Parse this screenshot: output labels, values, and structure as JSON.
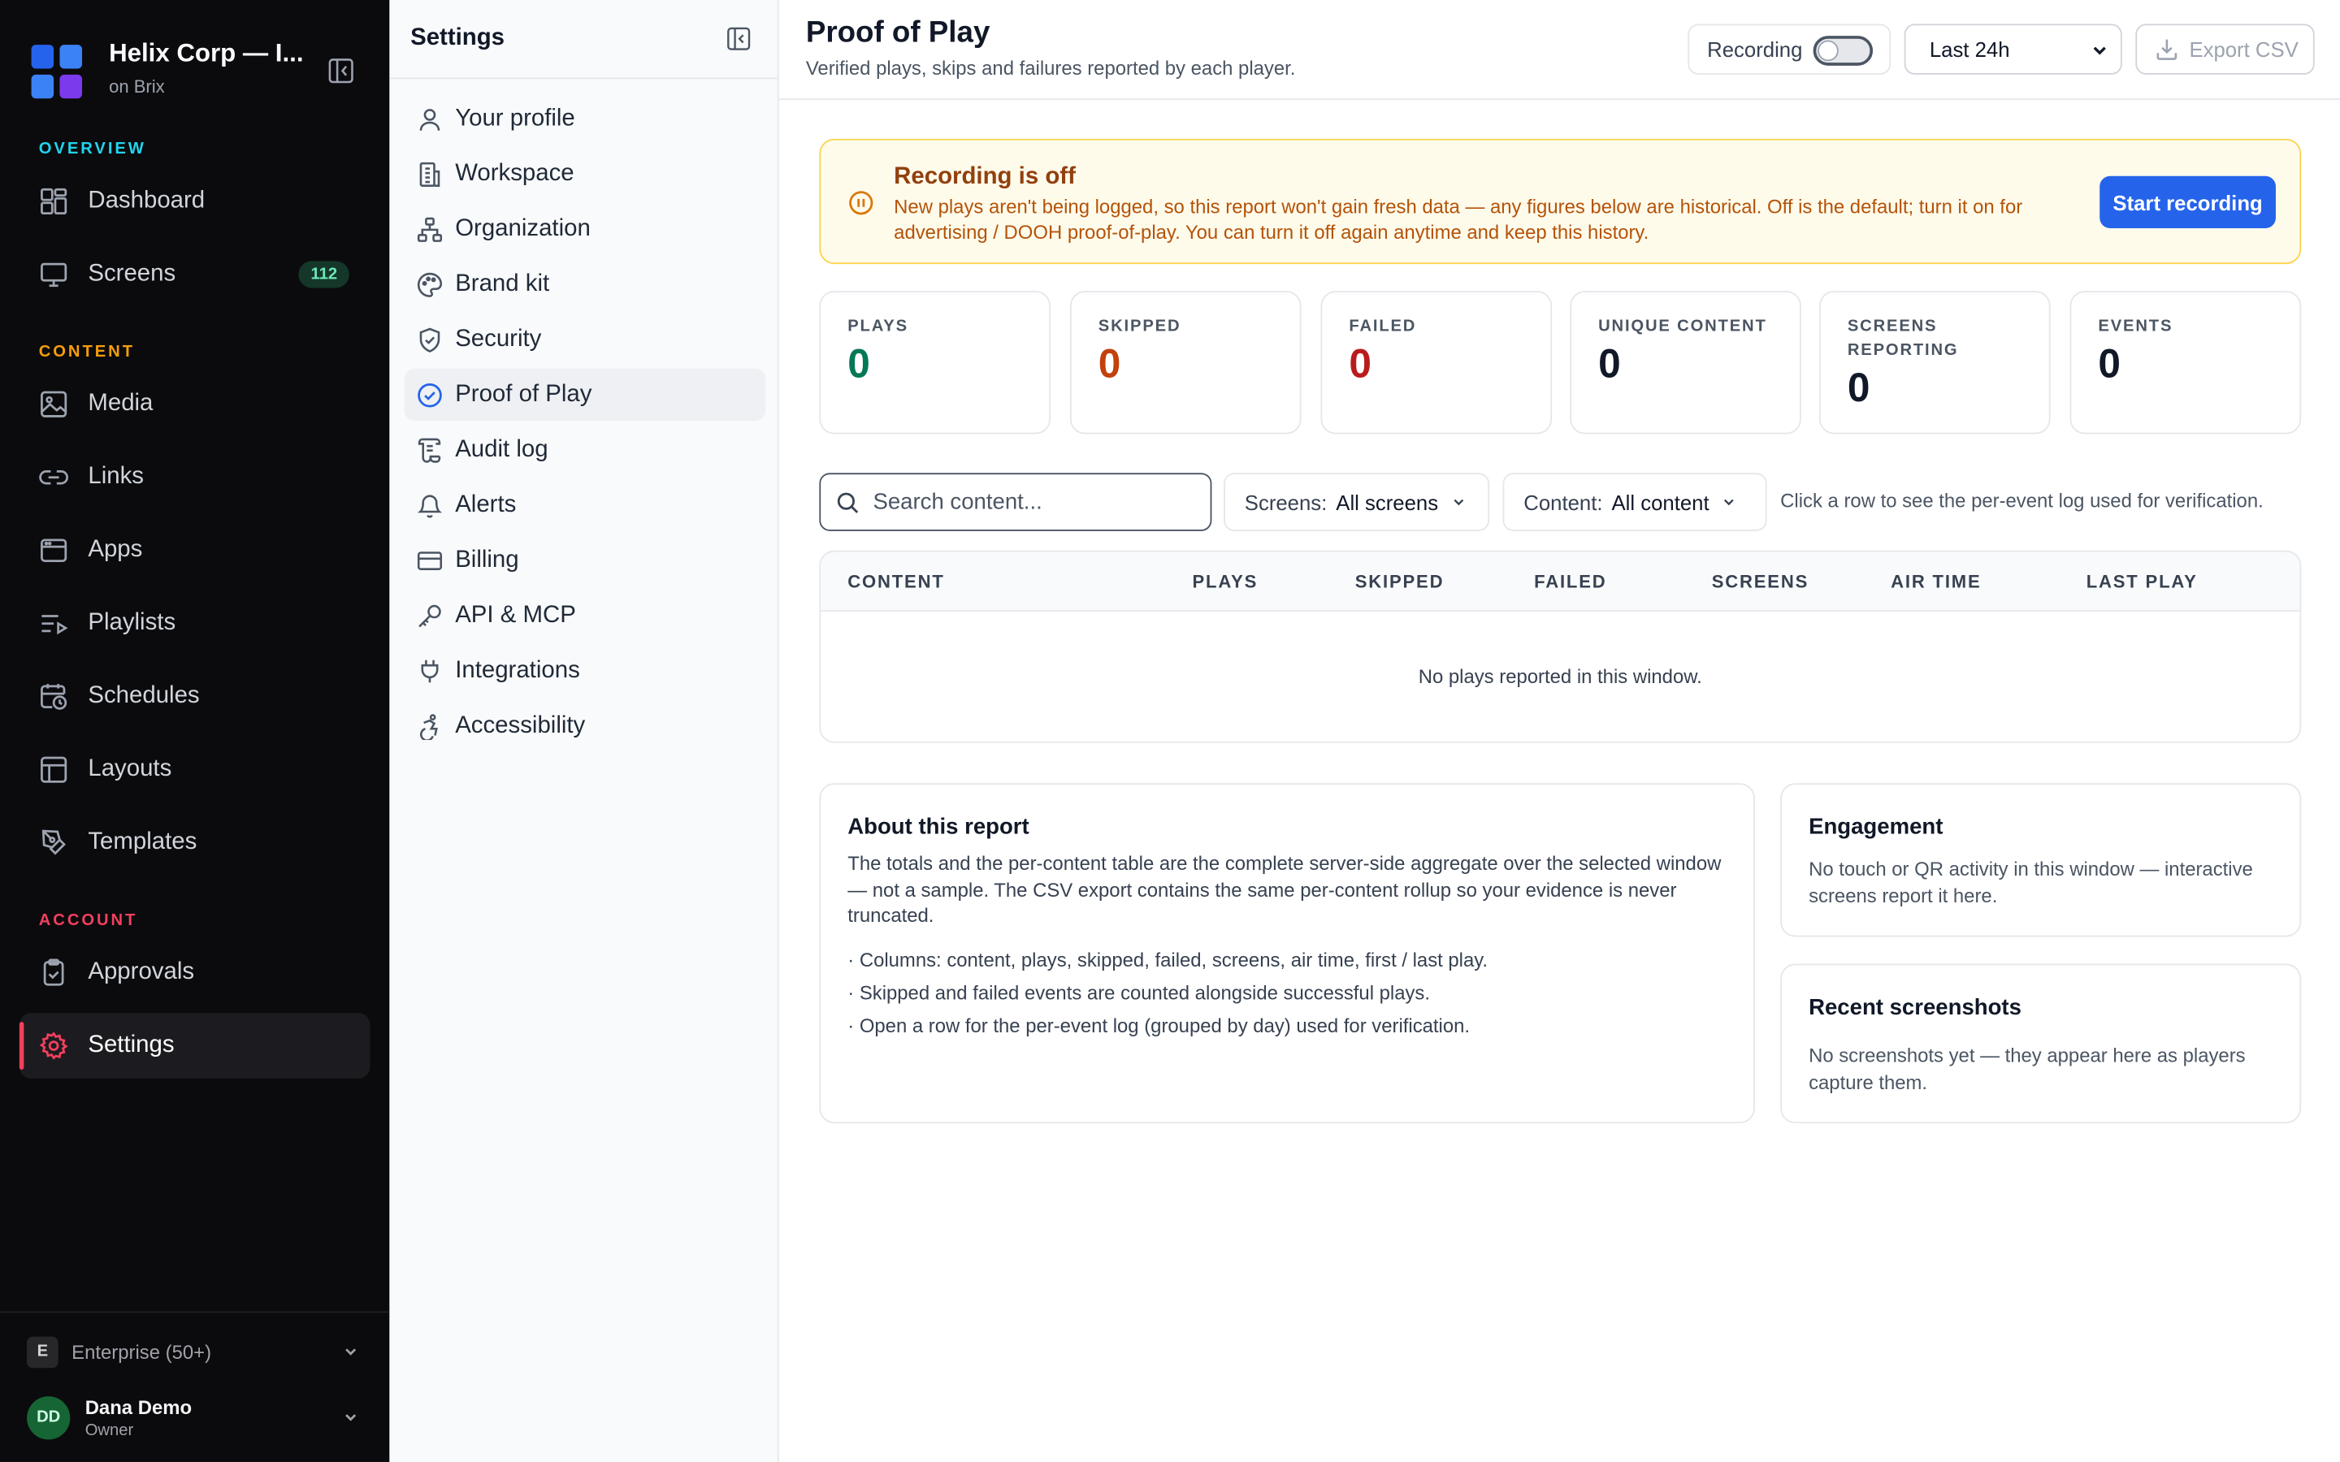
{
  "colors": {
    "logo_tiles": [
      "#2563eb",
      "#3b82f6",
      "#3b82f6",
      "#7c3aed"
    ],
    "overview_section": "#22d3ee",
    "content_section": "#f59e0b",
    "account_section": "#f43f5e",
    "plays_value": "#047857",
    "skipped_value": "#c2410c",
    "failed_value": "#b91c1c",
    "neutral_value": "#111827",
    "primary_button": "#2563eb"
  },
  "workspace": {
    "name": "Helix Corp — I...",
    "sub": "on Brix",
    "collapse_icon": "sidebar-collapse-icon"
  },
  "nav": {
    "overview_label": "OVERVIEW",
    "content_label": "CONTENT",
    "account_label": "ACCOUNT",
    "items": [
      {
        "label": "Dashboard",
        "icon": "dashboard-icon"
      },
      {
        "label": "Screens",
        "icon": "monitor-icon",
        "badge": "112"
      },
      {
        "label": "Media",
        "icon": "image-icon"
      },
      {
        "label": "Links",
        "icon": "link-icon"
      },
      {
        "label": "Apps",
        "icon": "app-window-icon"
      },
      {
        "label": "Playlists",
        "icon": "playlist-icon"
      },
      {
        "label": "Schedules",
        "icon": "calendar-clock-icon"
      },
      {
        "label": "Layouts",
        "icon": "layout-icon"
      },
      {
        "label": "Templates",
        "icon": "pen-tool-icon"
      },
      {
        "label": "Approvals",
        "icon": "clipboard-check-icon"
      },
      {
        "label": "Settings",
        "icon": "gear-icon",
        "active": true
      }
    ]
  },
  "plan": {
    "chip": "E",
    "label": "Enterprise (50+)"
  },
  "user": {
    "initials": "DD",
    "name": "Dana Demo",
    "role": "Owner"
  },
  "settings_nav": {
    "title": "Settings",
    "items": [
      {
        "label": "Your profile",
        "icon": "user-icon"
      },
      {
        "label": "Workspace",
        "icon": "building-icon"
      },
      {
        "label": "Organization",
        "icon": "org-chart-icon"
      },
      {
        "label": "Brand kit",
        "icon": "palette-icon"
      },
      {
        "label": "Security",
        "icon": "shield-icon"
      },
      {
        "label": "Proof of Play",
        "icon": "check-circle-icon",
        "active": true
      },
      {
        "label": "Audit log",
        "icon": "scroll-icon"
      },
      {
        "label": "Alerts",
        "icon": "bell-icon"
      },
      {
        "label": "Billing",
        "icon": "credit-card-icon"
      },
      {
        "label": "API & MCP",
        "icon": "key-icon"
      },
      {
        "label": "Integrations",
        "icon": "plug-icon"
      },
      {
        "label": "Accessibility",
        "icon": "accessibility-icon"
      }
    ]
  },
  "header": {
    "title": "Proof of Play",
    "subtitle": "Verified plays, skips and failures reported by each player.",
    "recording_label": "Recording",
    "recording_on": false,
    "range_value": "Last 24h",
    "export_label": "Export CSV"
  },
  "banner": {
    "title": "Recording is off",
    "description": "New plays aren't being logged, so this report won't gain fresh data — any figures below are historical. Off is the default; turn it on for advertising / DOOH proof-of-play. You can turn it off again anytime and keep this history.",
    "button": "Start recording"
  },
  "stats": [
    {
      "label": "PLAYS",
      "value": "0"
    },
    {
      "label": "SKIPPED",
      "value": "0"
    },
    {
      "label": "FAILED",
      "value": "0"
    },
    {
      "label": "UNIQUE CONTENT",
      "value": "0"
    },
    {
      "label": "SCREENS REPORTING",
      "value": "0"
    },
    {
      "label": "EVENTS",
      "value": "0"
    }
  ],
  "filters": {
    "search_placeholder": "Search content...",
    "screens_key": "Screens:",
    "screens_value": "All screens",
    "content_key": "Content:",
    "content_value": "All content",
    "hint": "Click a row to see the per-event log used for verification."
  },
  "table": {
    "columns": [
      "CONTENT",
      "PLAYS",
      "SKIPPED",
      "FAILED",
      "SCREENS",
      "AIR TIME",
      "LAST PLAY"
    ],
    "empty": "No plays reported in this window."
  },
  "about": {
    "title": "About this report",
    "body": "The totals and the per-content table are the complete server-side aggregate over the selected window — not a sample. The CSV export contains the same per-content rollup so your evidence is never truncated.",
    "bullets": [
      "· Columns: content, plays, skipped, failed, screens, air time, first / last play.",
      "· Skipped and failed events are counted alongside successful plays.",
      "· Open a row for the per-event log (grouped by day) used for verification."
    ]
  },
  "engagement": {
    "title": "Engagement",
    "body": "No touch or QR activity in this window — interactive screens report it here."
  },
  "screenshots": {
    "title": "Recent screenshots",
    "body": "No screenshots yet — they appear here as players capture them."
  }
}
